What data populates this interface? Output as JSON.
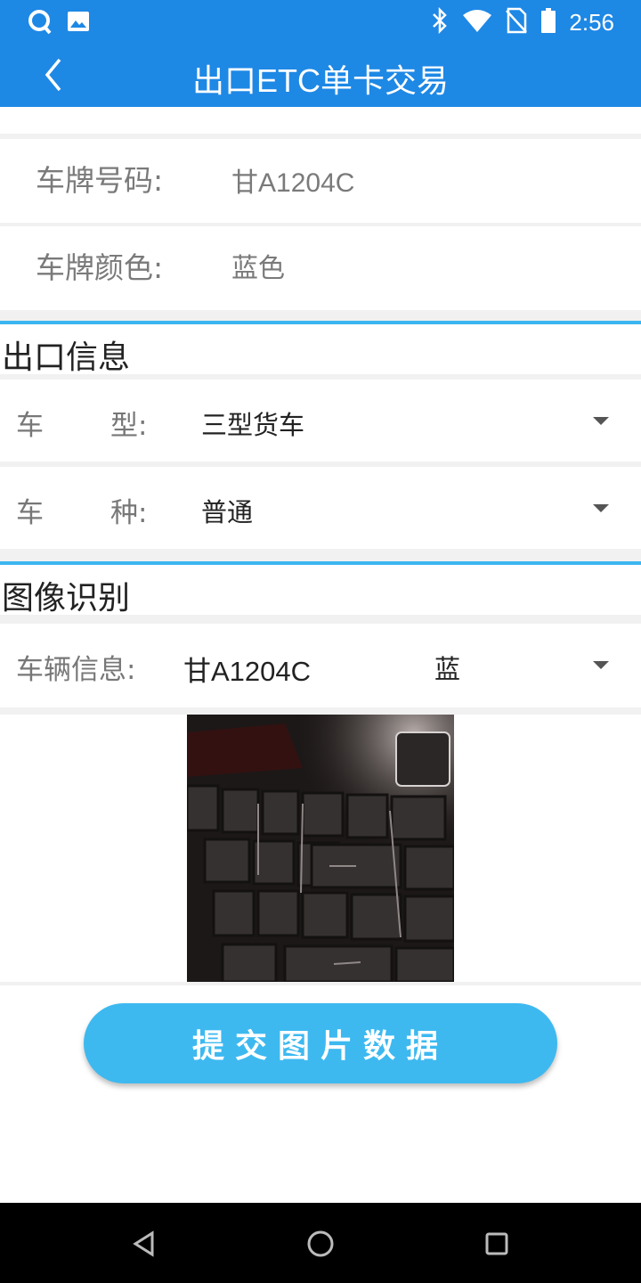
{
  "status_bar": {
    "time": "2:56",
    "left_icons": [
      "qq-icon",
      "image-icon"
    ],
    "right_icons": [
      "bluetooth-icon",
      "wifi-icon",
      "no-sim-icon",
      "battery-icon"
    ]
  },
  "header": {
    "title": "出口ETC单卡交易",
    "back_icon": "chevron-left-icon"
  },
  "plate_info": {
    "number_label": "车牌号码:",
    "number_value": "甘A1204C",
    "color_label": "车牌颜色:",
    "color_value": "蓝色"
  },
  "exit_info": {
    "section_title": "出口信息",
    "vehicle_type": {
      "label_a": "车",
      "label_b": "型:",
      "value": "三型货车"
    },
    "vehicle_kind": {
      "label_a": "车",
      "label_b": "种:",
      "value": "普通"
    }
  },
  "image_recognition": {
    "section_title": "图像识别",
    "vehicle_info_label": "车辆信息:",
    "plate": "甘A1204C",
    "color": "蓝"
  },
  "submit_label": "提交图片数据",
  "nav": [
    "back-triangle-icon",
    "home-circle-icon",
    "recents-square-icon"
  ],
  "colors": {
    "primary": "#1e88e5",
    "accent": "#3bb6f0",
    "button": "#3db9f0"
  }
}
